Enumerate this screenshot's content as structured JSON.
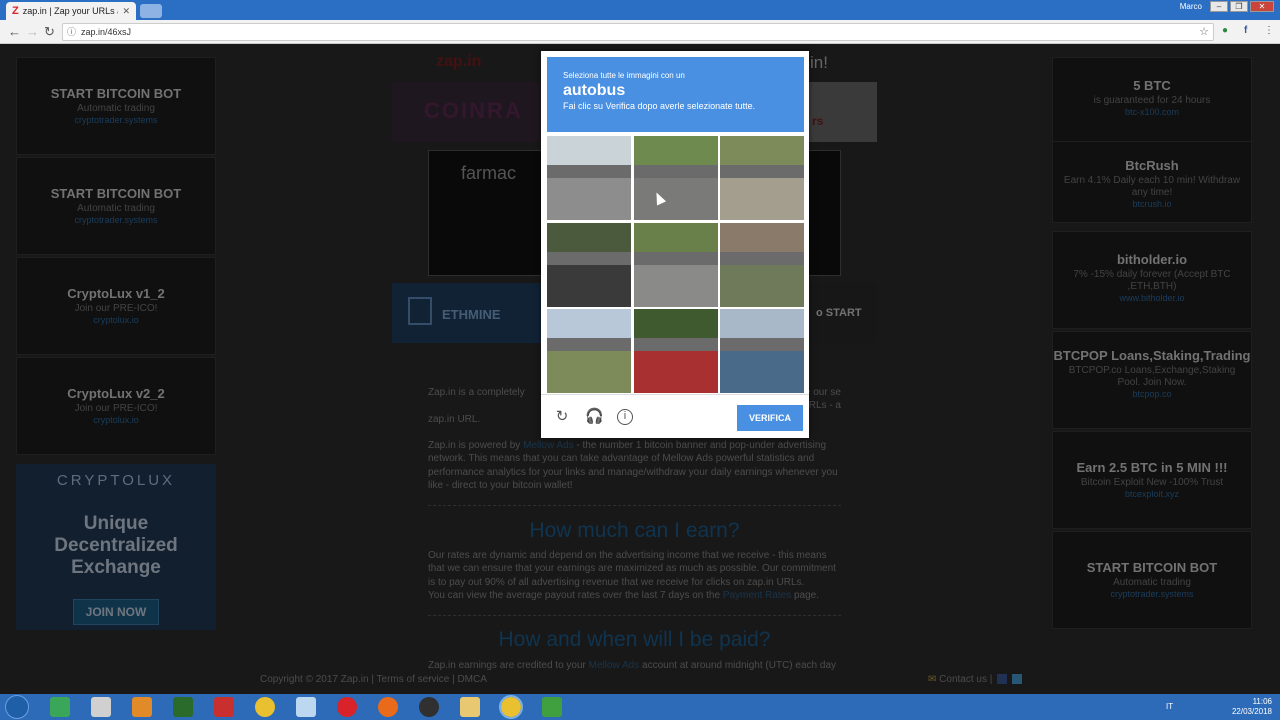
{
  "browser": {
    "tab_title": "zap.in | Zap your URLs a",
    "tab_favicon": "Z",
    "user": "Marco",
    "url": "zap.in/46xsJ"
  },
  "left_ads": [
    {
      "title": "START BITCOIN BOT",
      "subtitle": "Automatic trading",
      "link": "cryptotrader.systems"
    },
    {
      "title": "START BITCOIN BOT",
      "subtitle": "Automatic trading",
      "link": "cryptotrader.systems"
    },
    {
      "title": "CryptoLux v1_2",
      "subtitle": "Join our PRE-ICO!",
      "link": "cryptolux.io"
    },
    {
      "title": "CryptoLux v2_2",
      "subtitle": "Join our PRE-ICO!",
      "link": "cryptolux.io"
    }
  ],
  "cryptolux_banner": {
    "brand": "CRYPTOLUX",
    "line1": "Unique",
    "line2": "Decentralized",
    "line3": "Exchange",
    "button": "JOIN NOW"
  },
  "right_ads": [
    {
      "title": "5 BTC",
      "subtitle": "is guaranteed for 24 hours",
      "link": "btc-x100.com"
    },
    {
      "title": "BtcRush",
      "subtitle": "Earn 4.1% Daily each 10 min! Withdraw any time!",
      "link": "btcrush.io"
    },
    {
      "title": "bitholder.io",
      "subtitle": "7% -15% daily forever (Accept BTC ,ETH,BTH)",
      "link": "www.bitholder.io"
    },
    {
      "title": "BTCPOP Loans,Staking,Trading",
      "subtitle": "BTCPOP.co Loans,Exchange,Staking Pool. Join Now.",
      "link": "btcpop.co"
    },
    {
      "title": "Earn 2.5 BTC in 5 MIN !!!",
      "subtitle": "Bitcoin Exploit New -100% Trust",
      "link": "btcexploit.xyz"
    },
    {
      "title": "START BITCOIN BOT",
      "subtitle": "Automatic trading",
      "link": "cryptotrader.systems"
    }
  ],
  "center": {
    "header_left": "zap.in",
    "header_right": "in!",
    "banner_coinra": "COINRA",
    "banner_right_text": "rs",
    "shortbox_text": "farmac",
    "banner_ethmine": "ETHMINE",
    "banner_start": "o START",
    "para1_a": "Zap.in is a completely",
    "para1_b": "m your links! You can use our se",
    "para1_c": "n more convenient short URLs - a",
    "para1_d": "zap.in URL.",
    "para2_pre": "Zap.in is powered by ",
    "para2_link": "Mellow Ads",
    "para2_post": " - the number 1 bitcoin banner and pop-under advertising network. This means that you can take advantage of Mellow Ads powerful statistics and performance analytics for your links and manage/withdraw your daily earnings whenever you like - direct to your bitcoin wallet!",
    "h2_earn": "How much can I earn?",
    "para3": "Our rates are dynamic and depend on the advertising income that we receive - this means that we can ensure that your earnings are maximized as much as possible. Our commitment is to pay out 90% of all advertising revenue that we receive for clicks on zap.in URLs.",
    "para4_pre": "You can view the average payout rates over the last 7 days on the ",
    "para4_link": "Payment Rates",
    "para4_post": " page.",
    "h2_paid": "How and when will I be paid?",
    "para5_pre": "Zap.in earnings are credited to your ",
    "para5_link": "Mellow Ads",
    "para5_post": " account at around midnight (UTC) each day -"
  },
  "footer": {
    "left": "Copyright © 2017 Zap.in | Terms of service | DMCA",
    "right": "Contact us |"
  },
  "captcha": {
    "line1": "Seleziona tutte le immagini con un",
    "keyword": "autobus",
    "line3": "Fai clic su Verifica dopo averle selezionate tutte.",
    "verify": "VERIFICA",
    "tiles": [
      {
        "sky": "#c9d3d8",
        "road": "#8d8d8d"
      },
      {
        "sky": "#6f8a4e",
        "road": "#7a7a78"
      },
      {
        "sky": "#7d8a5a",
        "road": "#a39e8e"
      },
      {
        "sky": "#4b5a3c",
        "road": "#3a3a3a"
      },
      {
        "sky": "#69804a",
        "road": "#8a8a88"
      },
      {
        "sky": "#8a7a6a",
        "road": "#6e7a5a"
      },
      {
        "sky": "#b9c8d8",
        "road": "#7d8a5a"
      },
      {
        "sky": "#3f5a2e",
        "road": "#a83030"
      },
      {
        "sky": "#a8b8c8",
        "road": "#4a6a8a"
      }
    ]
  },
  "taskbar": {
    "lang": "IT",
    "time": "11:06",
    "date": "22/03/2018"
  }
}
